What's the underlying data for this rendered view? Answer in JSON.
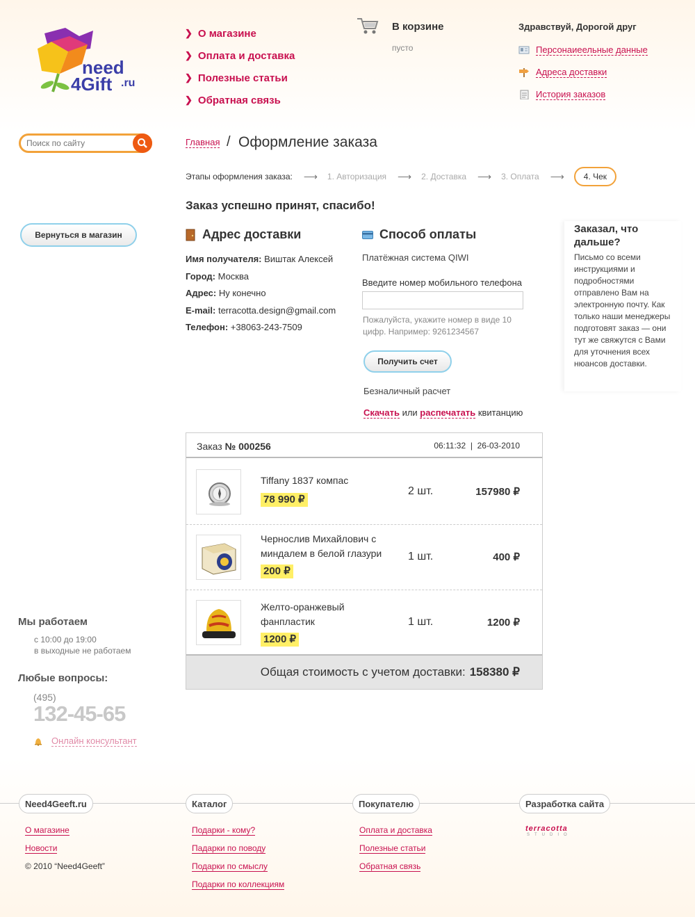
{
  "logo": {
    "text_main": "need",
    "text_sub": "4Gift",
    "text_tld": ".ru"
  },
  "nav": [
    {
      "label": "О магазине"
    },
    {
      "label": "Оплата и доставка"
    },
    {
      "label": "Полезные статьи"
    },
    {
      "label": "Обратная связь"
    }
  ],
  "cart": {
    "title": "В корзине",
    "status": "пусто"
  },
  "user": {
    "greeting": "Здравствуй, Дорогой друг",
    "links": [
      {
        "label": "Персонаиеельные данные",
        "icon": "id-card-icon"
      },
      {
        "label": "Адреса доставки",
        "icon": "signpost-icon"
      },
      {
        "label": "История заказов",
        "icon": "document-icon"
      }
    ]
  },
  "search": {
    "placeholder": "Поиск по сайту"
  },
  "back_button": "Вернуться в магазин",
  "breadcrumb": {
    "home": "Главная",
    "separator": "/",
    "current": "Оформление заказа"
  },
  "steps": {
    "label": "Этапы оформления заказа:",
    "items": [
      "1. Авторизация",
      "2. Доставка",
      "3. Оплата",
      "4. Чек"
    ],
    "active_index": 3
  },
  "success_message": "Заказ успешно принят, спасибо!",
  "address": {
    "title": "Адрес доставки",
    "fields": [
      {
        "label": "Имя получателя:",
        "value": "Виштак Алексей"
      },
      {
        "label": "Город:",
        "value": "Москва"
      },
      {
        "label": "Адрес:",
        "value": "Ну конечно"
      },
      {
        "label": "E-mail:",
        "value": "terracotta.design@gmail.com"
      },
      {
        "label": "Телефон:",
        "value": "+38063-243-7509"
      }
    ]
  },
  "payment": {
    "title": "Способ оплаты",
    "system": "Платёжная система QIWI",
    "phone_label": "Введите номер мобильного телефона",
    "phone_value": "",
    "hint": "Пожалуйста, укажите номер в виде 10 цифр. Например: 9261234567",
    "button": "Получить счет",
    "cashless": "Безналичный расчет",
    "download": "Скачать",
    "or": "или",
    "print": "распечатать",
    "receipt": "квитанцию"
  },
  "note": {
    "title": "Заказал, что дальше?",
    "text": "Письмо со всеми инструкциями и подробностями отправлено Вам на электронную почту. Как только наши менеджеры подготовят заказ — они тут же свяжутся с Вами для уточнения всех нюансов доставки."
  },
  "order": {
    "label": "Заказ",
    "number": "№ 000256",
    "time": "06:11:32",
    "date_sep": "|",
    "date": "26-03-2010",
    "items": [
      {
        "name": "Tiffany 1837 компас",
        "price": "78 990 ₽",
        "qty": "2 шт.",
        "sum": "157980 ₽"
      },
      {
        "name": "Чернослив Михайлович с миндалем в белой глазури",
        "price": "200 ₽",
        "qty": "1 шт.",
        "sum": "400 ₽"
      },
      {
        "name": "Желто-оранжевый фанпластик",
        "price": "1200 ₽",
        "qty": "1 шт.",
        "sum": "1200 ₽"
      }
    ],
    "total_label": "Общая стоимость с учетом доставки:",
    "total_value": "158380 ₽"
  },
  "left_info": {
    "work_title": "Мы работаем",
    "work_hours": "с 10:00 до 19:00",
    "work_weekend": "в выходные не работаем",
    "questions_title": "Любые вопросы:",
    "phone_code": "(495)",
    "phone_number": "132-45-65",
    "consultant": "Онлайн консультант"
  },
  "footer": {
    "col1": {
      "title": "Need4Geeft.ru",
      "links": [
        "О магазине",
        "Новости"
      ],
      "copyright": "© 2010 “Need4Geeft”"
    },
    "col2": {
      "title": "Каталог",
      "links": [
        "Подарки - кому?",
        "Падарки по поводу",
        "Подарки по смыслу",
        "Подарки по коллекциям"
      ]
    },
    "col3": {
      "title": "Покупателю",
      "links": [
        "Оплата и доставка",
        "Полезные статьи",
        "Обратная связь"
      ]
    },
    "col4": {
      "title": "Разработка сайта",
      "brand": "terracotta",
      "brand_sub": "STUDIO"
    }
  },
  "colors": {
    "accent": "#c8104f",
    "orange": "#f2a23a",
    "highlight": "#ffef66",
    "button_border": "#8fd0ea"
  }
}
